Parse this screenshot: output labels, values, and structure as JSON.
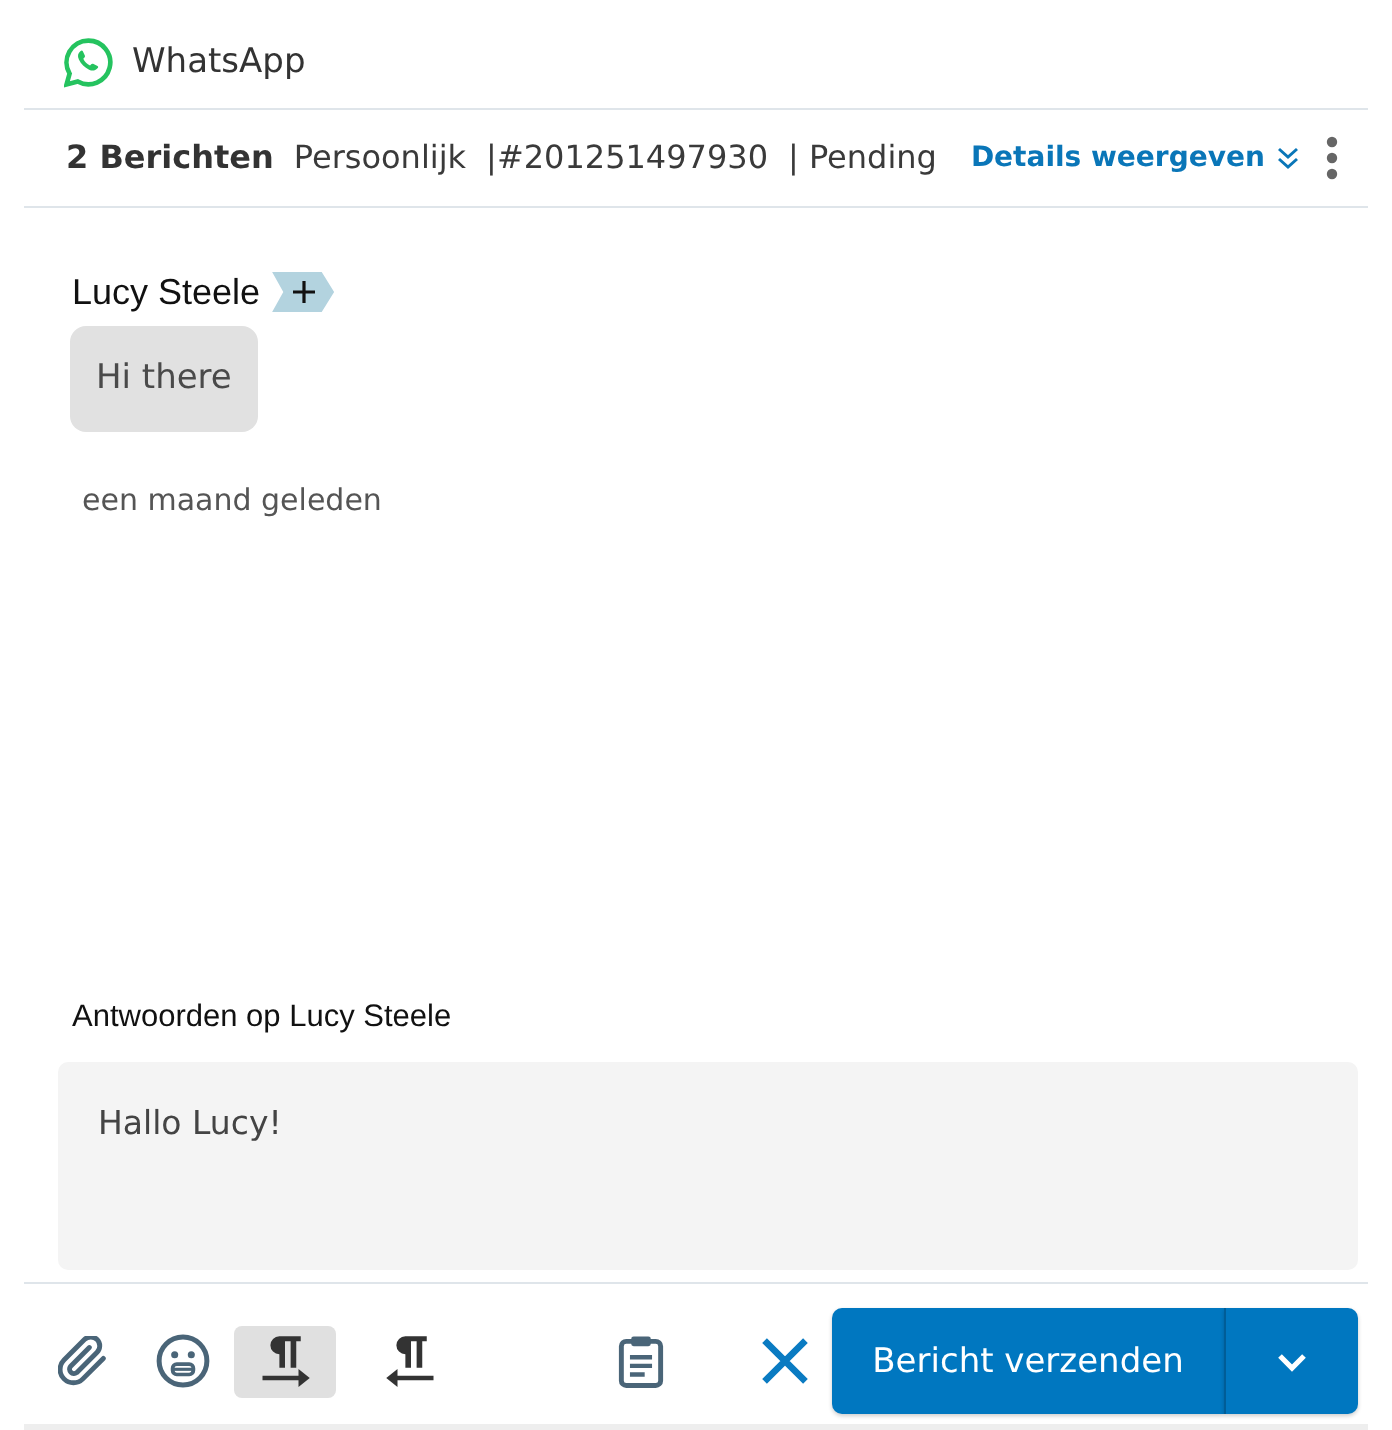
{
  "channel": {
    "name": "WhatsApp"
  },
  "info_bar": {
    "message_count": "2 Berichten",
    "category": "Persoonlijk",
    "ticket": "|#201251497930",
    "status": "| Pending",
    "details_link": "Details weergeven"
  },
  "messages": [
    {
      "sender": "Lucy Steele",
      "text": "Hi there",
      "time": "een maand geleden"
    }
  ],
  "reply": {
    "label": "Antwoorden op Lucy Steele",
    "value": "Hallo Lucy!"
  },
  "toolbar": {
    "tools": [
      {
        "kind": "attach"
      },
      {
        "kind": "emoji"
      }
    ],
    "direction": [
      {
        "kind": "ltr",
        "selected": true
      },
      {
        "kind": "rtl",
        "selected": false
      }
    ],
    "actions": [
      {
        "kind": "template"
      },
      {
        "kind": "cancel"
      }
    ]
  },
  "send_button": {
    "label": "Bericht verzenden"
  }
}
